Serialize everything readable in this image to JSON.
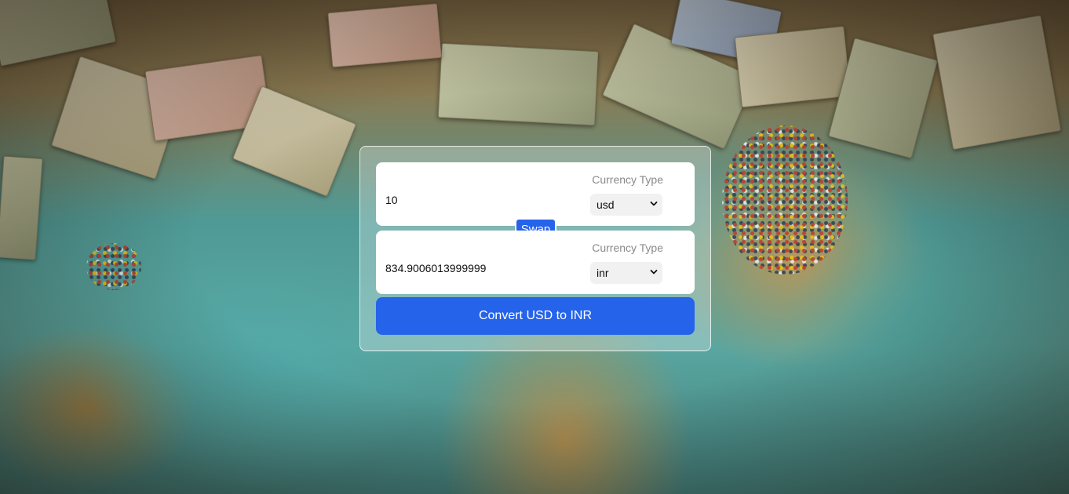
{
  "converter": {
    "from": {
      "amount": "10",
      "currency_label": "Currency Type",
      "selected_currency": "usd"
    },
    "to": {
      "amount": "834.9006013999999",
      "currency_label": "Currency Type",
      "selected_currency": "inr"
    },
    "swap_label": "Swap",
    "convert_label": "Convert USD to INR"
  },
  "colors": {
    "accent": "#2563eb",
    "field_background": "#ffffff",
    "select_background": "#f1f1f1",
    "label_text": "#8a8a8a"
  },
  "icons": {
    "select_indicator": "chevron-down-icon"
  }
}
